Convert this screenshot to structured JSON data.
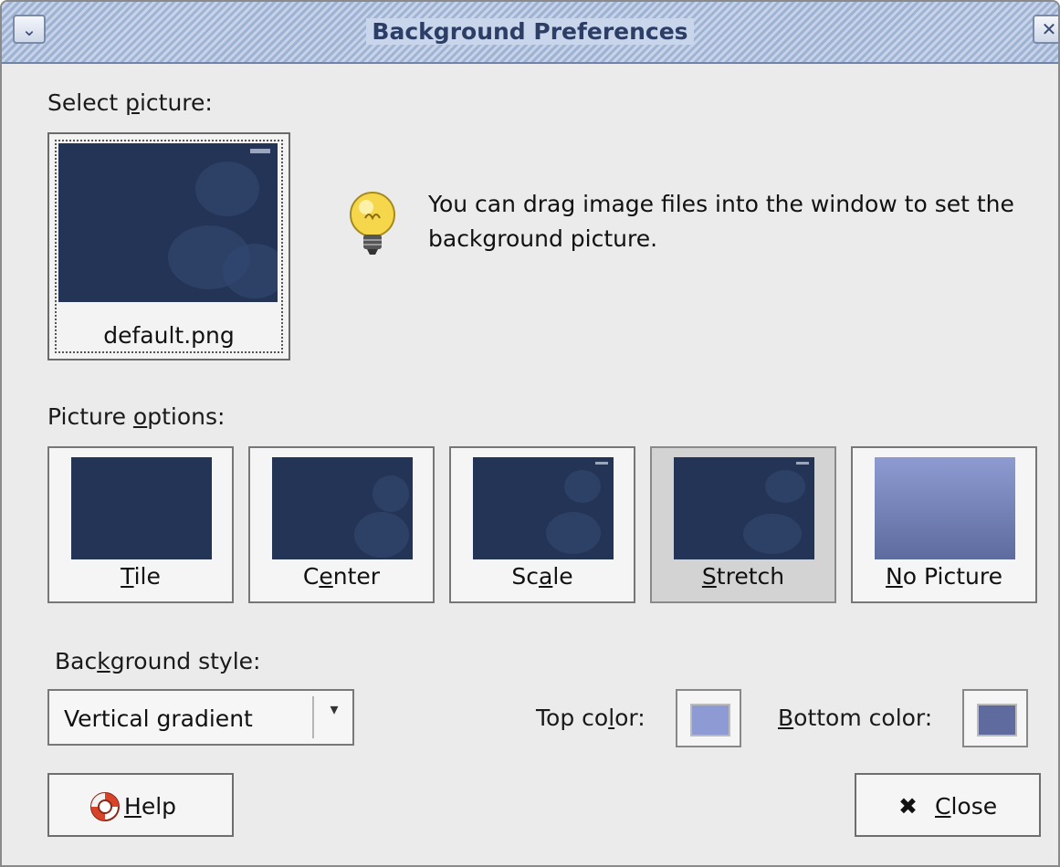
{
  "window": {
    "title": "Background Preferences"
  },
  "titlebar": {
    "menu_glyph": "⌄",
    "close_glyph": "✕"
  },
  "select_picture": {
    "label_before": "Select ",
    "label_mnemonic": "p",
    "label_after": "icture:",
    "filename": "default.png"
  },
  "hint": {
    "text": "You can drag image files into the window to set the background picture.",
    "icon": "lightbulb-icon"
  },
  "picture_options": {
    "label_before": "Picture ",
    "label_mnemonic": "o",
    "label_after": "ptions:",
    "items": [
      {
        "pre": "",
        "mn": "T",
        "post": "ile"
      },
      {
        "pre": "C",
        "mn": "e",
        "post": "nter"
      },
      {
        "pre": "Sc",
        "mn": "a",
        "post": "le"
      },
      {
        "pre": "",
        "mn": "S",
        "post": "tretch"
      },
      {
        "pre": "",
        "mn": "N",
        "post": "o Picture"
      }
    ],
    "selected": "Stretch"
  },
  "background_style": {
    "label_before": "Bac",
    "label_mnemonic": "k",
    "label_after": "ground style:",
    "value": "Vertical gradient",
    "arrow_glyph": "▾"
  },
  "colors": {
    "top_label_before": "Top co",
    "top_label_mnemonic": "l",
    "top_label_after": "or:",
    "top_color": "#8e9ad3",
    "bottom_label_before": "",
    "bottom_label_mnemonic": "B",
    "bottom_label_after": "ottom color:",
    "bottom_color": "#5f6b9f"
  },
  "buttons": {
    "help": {
      "mnemonic": "H",
      "rest": "elp",
      "icon": "lifebuoy-icon"
    },
    "close": {
      "mnemonic": "C",
      "rest": "lose",
      "icon": "x-icon",
      "glyph": "✖"
    }
  },
  "theme": {
    "title_text": "#2c3e66",
    "thumb_blue": "#243457"
  }
}
